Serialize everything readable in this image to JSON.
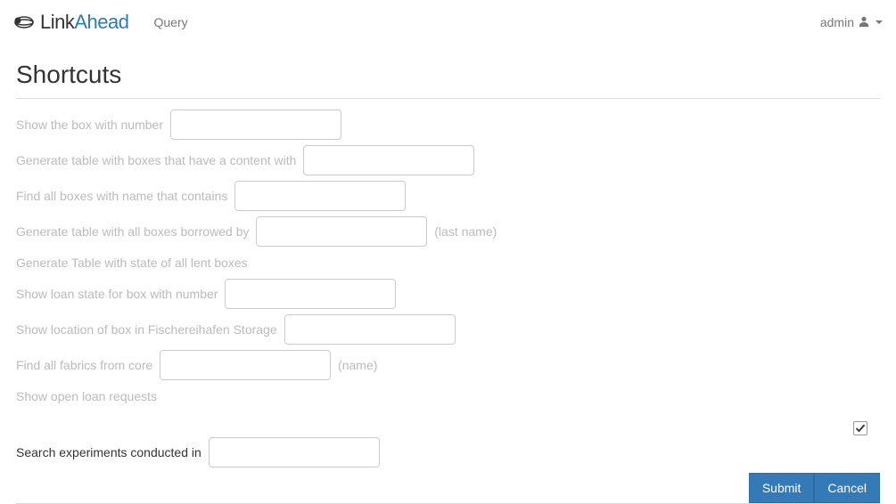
{
  "navbar": {
    "brand_prefix": "Link",
    "brand_suffix": "Ahead",
    "query_link": "Query",
    "user_label": "admin"
  },
  "shortcuts": {
    "title": "Shortcuts",
    "rows": [
      {
        "id": "box-number",
        "pre": "Show the box with number ",
        "post": "",
        "has_input": true
      },
      {
        "id": "table-content",
        "pre": "Generate table with boxes that have a content with ",
        "post": "",
        "has_input": true
      },
      {
        "id": "boxes-name",
        "pre": "Find all boxes with name that contains ",
        "post": "",
        "has_input": true
      },
      {
        "id": "borrowed-by",
        "pre": "Generate table with all boxes borrowed by ",
        "post": " (last name)",
        "has_input": true
      },
      {
        "id": "lent-boxes",
        "pre": "Generate Table with state of all lent boxes",
        "post": "",
        "has_input": false
      },
      {
        "id": "loan-state",
        "pre": "Show loan state for box with number ",
        "post": "",
        "has_input": true
      },
      {
        "id": "fischereihafen",
        "pre": "Show location of box in Fischereihafen Storage ",
        "post": "",
        "has_input": true
      },
      {
        "id": "fabrics-core",
        "pre": "Find all fabrics from core ",
        "post": " (name)",
        "has_input": true
      },
      {
        "id": "open-loan",
        "pre": "Show open loan requests",
        "post": "",
        "has_input": false
      }
    ],
    "active_row": {
      "id": "experiments",
      "pre": "Search experiments conducted in ",
      "post": ""
    }
  },
  "buttons": {
    "submit": "Submit",
    "cancel": "Cancel"
  }
}
